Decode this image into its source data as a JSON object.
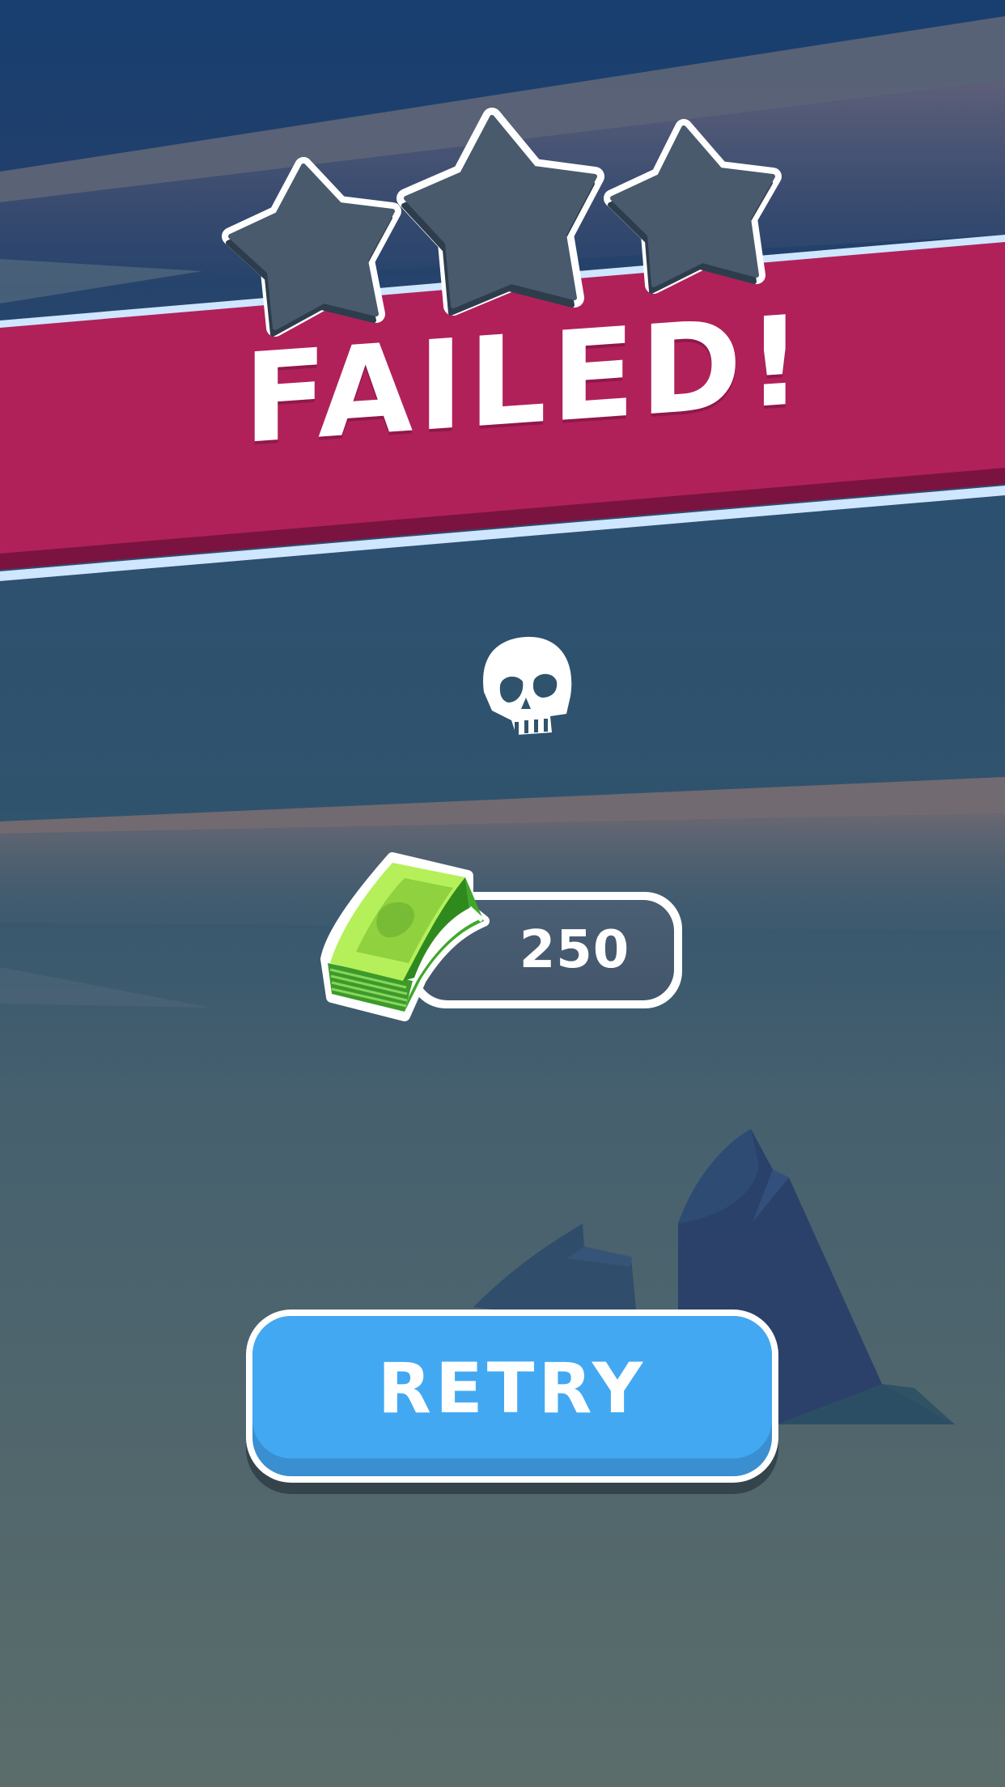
{
  "result": {
    "title": "FAILED!",
    "stars_earned": 0,
    "stars_total": 3
  },
  "reward": {
    "icon": "cash-stack-icon",
    "amount": "250"
  },
  "status_icon": "skull-icon",
  "retry_button": {
    "label": "RETRY"
  },
  "colors": {
    "banner": "#b0215a",
    "banner_shadow": "#7a1340",
    "banner_trim": "#cfe6ff",
    "sky_top": "#173f70",
    "background_mid": "#30536d",
    "background_bottom": "#5a6c6a",
    "star_empty": "#485a6c",
    "button": "#43a8f2",
    "button_shade": "#3a8fd0",
    "counter_pill": "#475a6f",
    "cash_light": "#b5f05a",
    "cash_dark": "#2f8a1e"
  }
}
